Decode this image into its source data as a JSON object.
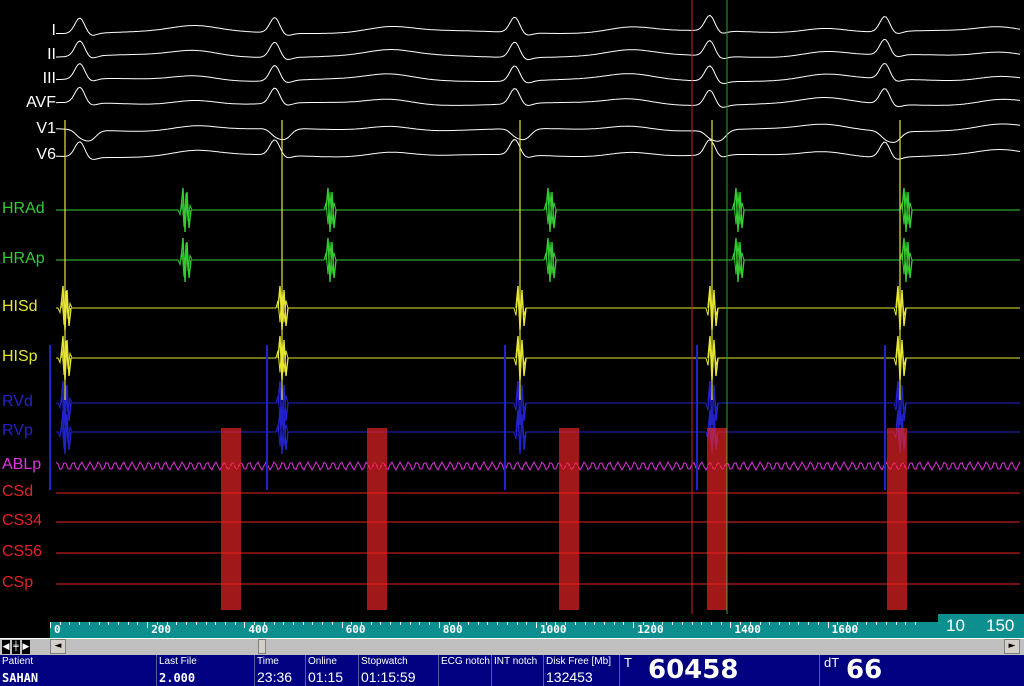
{
  "channels": [
    {
      "label": "I",
      "color": "#ffffff"
    },
    {
      "label": "II",
      "color": "#ffffff"
    },
    {
      "label": "III",
      "color": "#ffffff"
    },
    {
      "label": "AVF",
      "color": "#ffffff"
    },
    {
      "label": "V1",
      "color": "#ffffff"
    },
    {
      "label": "V6",
      "color": "#ffffff"
    },
    {
      "label": "HRAd",
      "color": "#33cc33"
    },
    {
      "label": "HRAp",
      "color": "#33cc33"
    },
    {
      "label": "HISd",
      "color": "#e6e633"
    },
    {
      "label": "HISp",
      "color": "#e6e633"
    },
    {
      "label": "RVd",
      "color": "#2222cc"
    },
    {
      "label": "RVp",
      "color": "#2222cc"
    },
    {
      "label": "ABLp",
      "color": "#e033e0"
    },
    {
      "label": "CSd",
      "color": "#e62222"
    },
    {
      "label": "CS34",
      "color": "#e62222"
    },
    {
      "label": "CS56",
      "color": "#e62222"
    },
    {
      "label": "CSp",
      "color": "#e62222"
    }
  ],
  "timescale": {
    "ticks": [
      "0",
      "200",
      "400",
      "600",
      "800",
      "1000",
      "1200",
      "1400",
      "1600"
    ],
    "scale_left": "10",
    "scale_right": "150"
  },
  "cursors": {
    "red_color": "#cc2222",
    "green_color": "#22aa22"
  },
  "scrollbar": {
    "left_arrow": "◄",
    "right_arrow": "►"
  },
  "status": {
    "patient_label": "Patient",
    "patient_value": "SAHAN",
    "last_file_label": "Last File",
    "last_file_value": "2.000",
    "time_label": "Time",
    "time_value": "23:36",
    "online_label": "Online",
    "online_value": "01:15",
    "stopwatch_label": "Stopwatch",
    "stopwatch_value": "01:15:59",
    "ecg_notch_label": "ECG notch",
    "int_notch_label": "INT notch",
    "disk_free_label": "Disk Free [Mb]",
    "disk_free_value": "132453",
    "t_label": "T",
    "t_value": "60458",
    "dt_label": "dT",
    "dt_value": "66"
  }
}
